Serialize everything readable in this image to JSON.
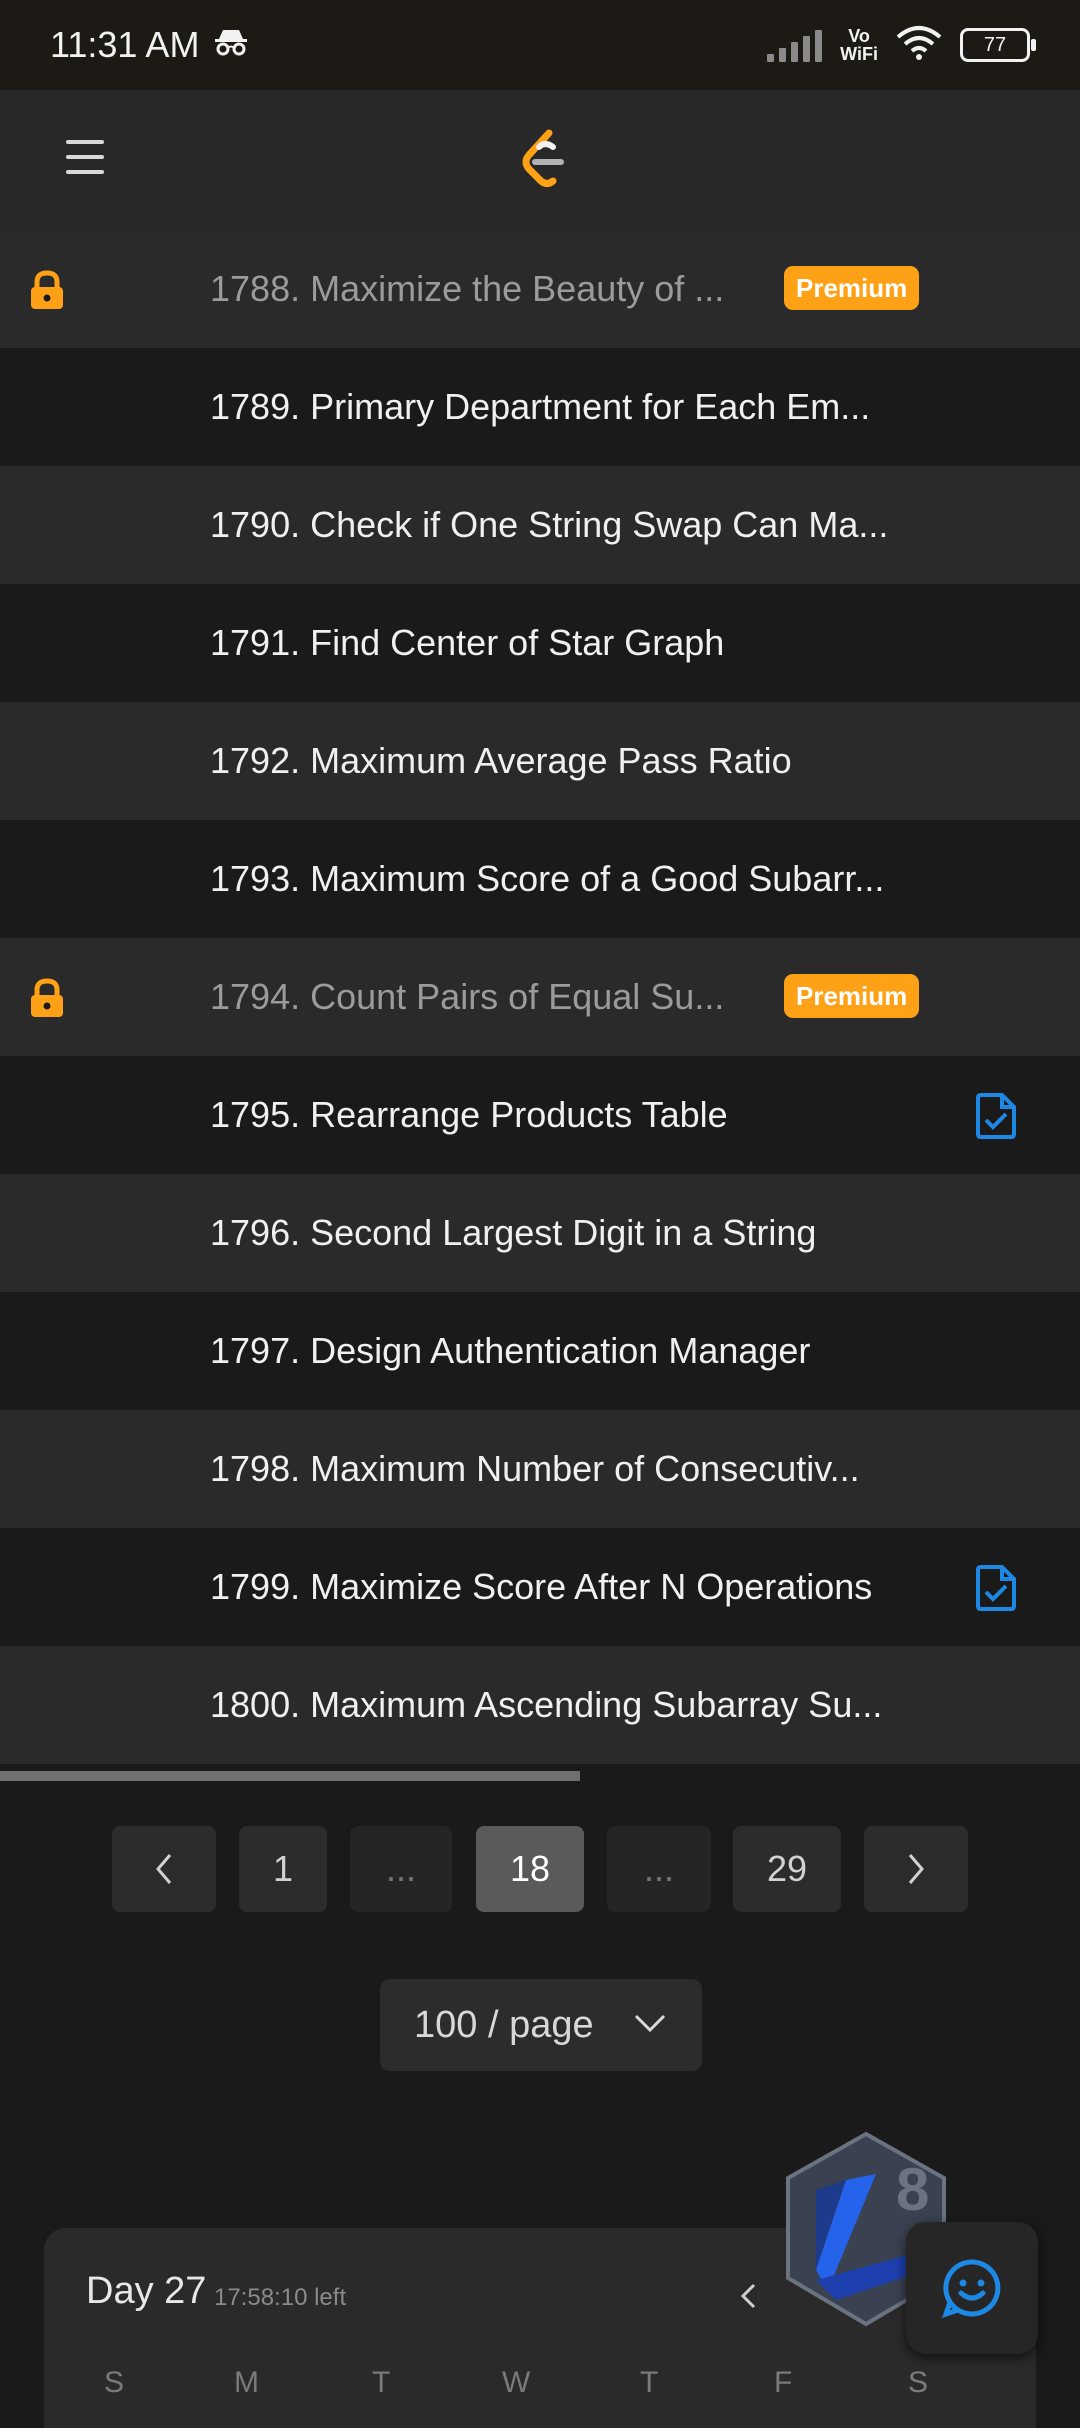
{
  "status_bar": {
    "time": "11:31 AM",
    "battery": "77",
    "network": "Vo\nWiFi"
  },
  "problems": [
    {
      "title": "1788. Maximize the Beauty of ...",
      "locked": true,
      "badge": "Premium"
    },
    {
      "title": "1789. Primary Department for Each Em..."
    },
    {
      "title": "1790. Check if One String Swap Can Ma..."
    },
    {
      "title": "1791. Find Center of Star Graph"
    },
    {
      "title": "1792. Maximum Average Pass Ratio"
    },
    {
      "title": "1793. Maximum Score of a Good Subarr..."
    },
    {
      "title": "1794. Count Pairs of Equal Su...",
      "locked": true,
      "badge": "Premium"
    },
    {
      "title": "1795. Rearrange Products Table",
      "solution_icon": true
    },
    {
      "title": "1796. Second Largest Digit in a String"
    },
    {
      "title": "1797. Design Authentication Manager"
    },
    {
      "title": "1798. Maximum Number of Consecutiv..."
    },
    {
      "title": "1799. Maximize Score After N Operations",
      "solution_icon": true
    },
    {
      "title": "1800. Maximum Ascending Subarray Su..."
    }
  ],
  "pagination": {
    "prev": "‹",
    "next": "›",
    "pages": [
      "1",
      "...",
      "18",
      "...",
      "29"
    ],
    "current": "18"
  },
  "page_size": {
    "label": "100 / page"
  },
  "calendar": {
    "day_label": "Day 27",
    "time_left": "17:58:10 left",
    "weekdays": [
      "S",
      "M",
      "T",
      "W",
      "T",
      "F",
      "S"
    ]
  },
  "colors": {
    "accent": "#ffa116",
    "solution": "#1e88e5",
    "background": "#1a1a1a"
  }
}
